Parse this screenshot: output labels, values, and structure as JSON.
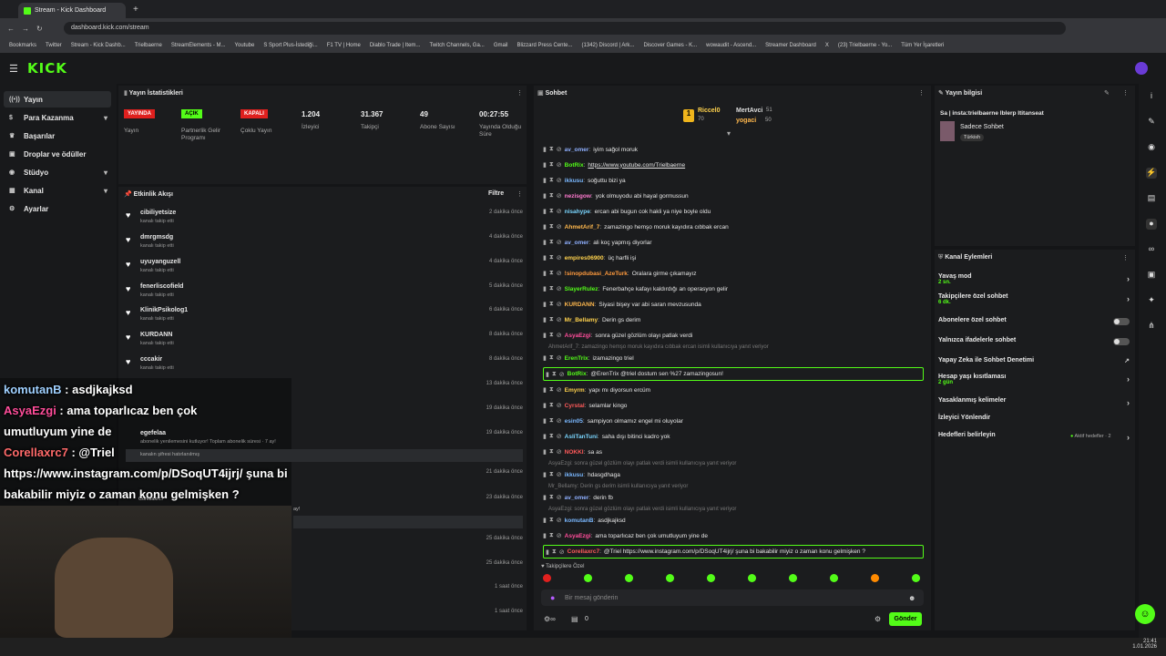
{
  "browser": {
    "tab_title": "Stream - Kick Dashboard",
    "url": "dashboard.kick.com/stream",
    "bookmarks": [
      "Bookmarks",
      "Twitter",
      "Stream - Kick Dashb...",
      "Trielbaerne",
      "StreamElements - M...",
      "Youtube",
      "S Sport Plus-İstediği...",
      "F1 TV | Home",
      "Diablo Trade | Item...",
      "Twitch Channels, Ga...",
      "Gmail",
      "Blizzard Press Cente...",
      "(1342) Discord | Ark...",
      "Discover Games - K...",
      "wowaudit - Ascend...",
      "Streamer Dashboard",
      "X",
      "(23) Trielbaerne - Yo...",
      "Tüm Yer İşaretleri"
    ]
  },
  "sidebar": {
    "items": [
      {
        "label": "Yayın",
        "icon": "broadcast-icon"
      },
      {
        "label": "Para Kazanma",
        "icon": "dollar-icon"
      },
      {
        "label": "Başarılar",
        "icon": "trophy-icon"
      },
      {
        "label": "Droplar ve ödüller",
        "icon": "gift-icon"
      },
      {
        "label": "Stüdyo",
        "icon": "studio-icon"
      },
      {
        "label": "Kanal",
        "icon": "channel-icon"
      },
      {
        "label": "Ayarlar",
        "icon": "gear-icon"
      }
    ]
  },
  "stats": {
    "title": "Yayın İstatistikleri",
    "items": [
      {
        "badge": "YAYINDA",
        "label": "Yayın",
        "color": "#e0201e"
      },
      {
        "badge": "AÇIK",
        "label": "Partnerlik Gelir Programı",
        "color": "#53fc18"
      },
      {
        "badge": "KAPALI",
        "label": "Çoklu Yayın",
        "color": "#e0201e"
      },
      {
        "value": "1.204",
        "label": "İzleyici"
      },
      {
        "value": "31.367",
        "label": "Takipçi"
      },
      {
        "value": "49",
        "label": "Abone Sayısı"
      },
      {
        "value": "00:27:55",
        "label": "Yayında Olduğu Süre"
      }
    ]
  },
  "activity": {
    "title": "Etkinlik Akışı",
    "filter": "Filtre",
    "events": [
      {
        "name": "cibiliyetsize",
        "sub": "kanalı takip etti",
        "time": "2 dakika önce"
      },
      {
        "name": "dmrgmsdg",
        "sub": "kanalı takip etti",
        "time": "4 dakika önce"
      },
      {
        "name": "uyuyanguzell",
        "sub": "kanalı takip etti",
        "time": "4 dakika önce"
      },
      {
        "name": "fenerliscofield",
        "sub": "kanalı takip etti",
        "time": "5 dakika önce"
      },
      {
        "name": "KlinikPsikolog1",
        "sub": "kanalı takip etti",
        "time": "6 dakika önce"
      },
      {
        "name": "KURDANN",
        "sub": "kanalı takip etti",
        "time": "8 dakika önce"
      },
      {
        "name": "cccakir",
        "sub": "kanalı takip etti",
        "time": "8 dakika önce"
      },
      {
        "name": "",
        "sub": "",
        "time": "13 dakika önce"
      },
      {
        "name": "",
        "sub": "",
        "time": "19 dakika önce"
      },
      {
        "name": "egefelaa",
        "sub": "abonelik yenilemesini kutluyor! Toplam abonelik süresi · 7 ay!",
        "time": "19 dakika önce"
      },
      {
        "name": "",
        "sub": "",
        "time": "21 dakika önce"
      },
      {
        "name": "",
        "sub": "",
        "time": "23 dakika önce"
      },
      {
        "name": "",
        "sub": "",
        "time": "25 dakika önce"
      },
      {
        "name": "",
        "sub": "",
        "time": "25 dakika önce"
      },
      {
        "name": "",
        "sub": "",
        "time": "1 saat önce"
      },
      {
        "name": "",
        "sub": "",
        "time": "1 saat önce"
      }
    ],
    "extra_lines": [
      "kanalın şifresi hatırlanılmış",
      "Corellaxrc7",
      "ay!"
    ]
  },
  "chat": {
    "title": "Sohbet",
    "top_gifters": [
      {
        "name": "Riccel0",
        "count": "70"
      },
      {
        "name": "MertAvci",
        "count": "51"
      },
      {
        "name": "yogaci",
        "count": "50"
      }
    ],
    "messages": [
      {
        "user": "av_omer",
        "color": "#8fb0ff",
        "text": "iyim sağol moruk"
      },
      {
        "user": "BotRix",
        "color": "#53fc18",
        "text": "https://www.youtube.com/Trielbaerne",
        "link": true
      },
      {
        "user": "ikkusu",
        "color": "#7ab8ff",
        "text": "soğuttu bizi ya"
      },
      {
        "user": "nezisgow",
        "color": "#ff7ad0",
        "text": "yok olmuyodu abi hayal gormussun"
      },
      {
        "user": "nisahype",
        "color": "#7ad6ff",
        "text": "ercan abi bugun cok hakli ya niye boyle oldu"
      },
      {
        "user": "AhmetArif_7",
        "color": "#ffb84d",
        "text": "zamazingo hemşo moruk kayıdıra cıbbak ercan"
      },
      {
        "user": "av_omer",
        "color": "#8fb0ff",
        "text": "ali koç yapmış diyorlar"
      },
      {
        "user": "empires06900",
        "color": "#ffd24d",
        "text": "üç harfli işi"
      },
      {
        "user": "!sinopdubasi_AzeTurk",
        "color": "#ff9a3d",
        "text": "Oralara girme çıkamayız"
      },
      {
        "user": "SlayerRulez",
        "color": "#53fc18",
        "text": "Fenerbahçe kafayı kaldırdığı an operasyon gelir"
      },
      {
        "user": "KURDANN",
        "color": "#ffb84d",
        "text": "Siyasi bişey var abi saran mevzusunda"
      },
      {
        "user": "Mr_Bellamy",
        "color": "#ffd24d",
        "text": "Derin gs derim"
      },
      {
        "user": "AsyaEzgi",
        "color": "#ff4d9a",
        "text": "sonra güzel gözlüm olayı patlak verdi"
      },
      {
        "user": "ErenTrix",
        "color": "#53fc18",
        "text": "izamazingo triel"
      },
      {
        "user": "BotRix",
        "color": "#53fc18",
        "text": "@ErenTrix @triel dostum sen %27 zamazingosun!"
      },
      {
        "user": "Emyrm",
        "color": "#ffd24d",
        "text": "yapı mı diyorsun ercüm"
      },
      {
        "user": "Cyrstal",
        "color": "#ff5a5a",
        "text": "selamlar kingo"
      },
      {
        "user": "esin05",
        "color": "#7ab8ff",
        "text": "sampiyon olmamız engel mi oluyolar"
      },
      {
        "user": "AsliTanTuni",
        "color": "#7ad6ff",
        "text": "saha dışı bitinci kadro yok"
      },
      {
        "user": "NOKKI",
        "color": "#ff5a5a",
        "text": "sa as"
      },
      {
        "user": "ikkusu",
        "color": "#7ab8ff",
        "text": "hdasgdhaga"
      },
      {
        "user": "av_omer",
        "color": "#8fb0ff",
        "text": "derin fb"
      },
      {
        "user": "komutanB",
        "color": "#7ab8ff",
        "text": "asdjkajksd"
      },
      {
        "user": "AsyaEzgi",
        "color": "#ff4d9a",
        "text": "ama toparlıcaz ben çok umutluyum yine de"
      },
      {
        "user": "Corellaxrc7",
        "color": "#ff5a5a",
        "text": "@Triel https://www.instagram.com/p/DSoqUT4ijrj/ şuna bi bakabilir miyiz o zaman konu gelmişken ?"
      }
    ],
    "replies": [
      "AhmetArif_7: zamazingo hemşo moruk kayıdıra cıbbak ercan isimli kullanıcıya yanıt veriyor",
      "AsyaEzgi: sonra güzel gözlüm olayı patlak verdi isimli kullanıcıya yanıt veriyor",
      "Mr_Bellamy: Derin gs derim isimli kullanıcıya yanıt veriyor",
      "AsyaEzgi: sonra güzel gözlüm olayı patlak verdi isimli kullanıcıya yanıt veriyor"
    ],
    "followers_only": "Takipçilere Özel",
    "input_placeholder": "Bir mesaj gönderin",
    "send": "Gönder",
    "counter": "0"
  },
  "stream_info": {
    "title": "Yayın bilgisi",
    "stream_title": "Sa | insta:trielbaerne Iblerp Ititanseat",
    "category": "Sadece Sohbet",
    "tag": "Türkish"
  },
  "channel_actions": {
    "title": "Kanal Eylemleri",
    "items": [
      {
        "label": "Yavaş mod",
        "sub": "2 sn."
      },
      {
        "label": "Takipçilere özel sohbet",
        "sub": "6 dk."
      },
      {
        "label": "Abonelere özel sohbet",
        "sub": ""
      },
      {
        "label": "Yalnızca ifadelerle sohbet",
        "sub": ""
      },
      {
        "label": "Yapay Zeka ile Sohbet Denetimi",
        "sub": ""
      },
      {
        "label": "Hesap yaşı kısıtlaması",
        "sub": "2 gün"
      },
      {
        "label": "Yasaklanmış kelimeler",
        "sub": ""
      },
      {
        "label": "İzleyici Yönlendir",
        "sub": ""
      },
      {
        "label": "Hedefleri belirleyin",
        "sub": ""
      }
    ],
    "goals_status": "Aktif hedefler · 2"
  },
  "overlay": {
    "lines": [
      {
        "user": "komutanB",
        "text": " : asdjkajksd"
      },
      {
        "user": "AsyaEzgi",
        "text": " : ama toparlıcaz ben çok"
      },
      {
        "user": "",
        "text": "umutluyum yine de"
      },
      {
        "user": "Corellaxrc7",
        "text": " : @Triel"
      },
      {
        "user": "",
        "text": "https://www.instagram.com/p/DSoqUT4ijrj/ şuna bi"
      },
      {
        "user": "",
        "text": "bakabilir miyiz o zaman konu gelmişken ?"
      }
    ]
  },
  "taskbar": {
    "time": "21:41",
    "date": "1.01.2026"
  }
}
